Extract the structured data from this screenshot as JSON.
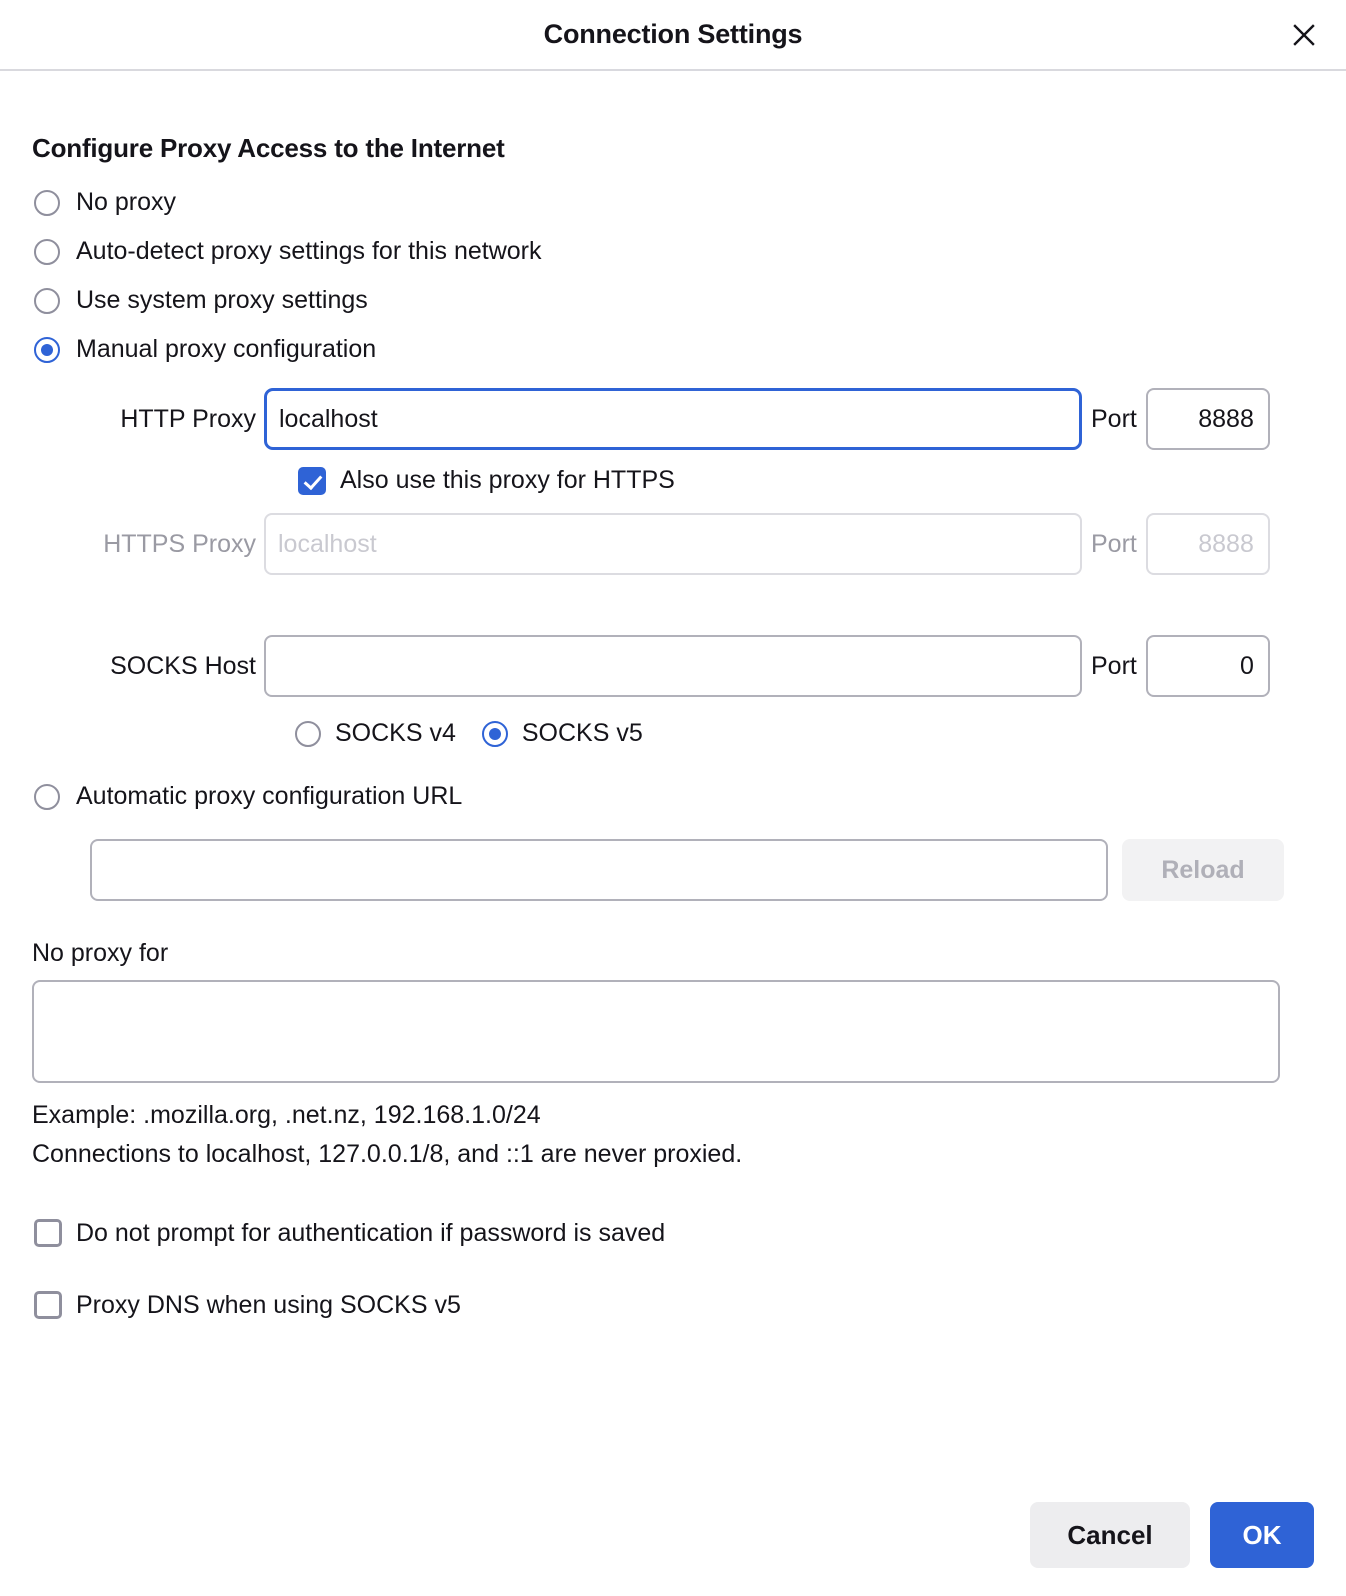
{
  "dialog": {
    "title": "Connection Settings",
    "close_icon": "close-icon"
  },
  "section": {
    "heading": "Configure Proxy Access to the Internet"
  },
  "proxy_modes": [
    {
      "label": "No proxy",
      "selected": false
    },
    {
      "label": "Auto-detect proxy settings for this network",
      "selected": false
    },
    {
      "label": "Use system proxy settings",
      "selected": false
    },
    {
      "label": "Manual proxy configuration",
      "selected": true
    }
  ],
  "manual": {
    "http": {
      "label": "HTTP Proxy",
      "value": "localhost",
      "placeholder": "",
      "focused": true,
      "port_label": "Port",
      "port_value": "8888"
    },
    "also_https": {
      "label": "Also use this proxy for HTTPS",
      "checked": true
    },
    "https": {
      "label": "HTTPS Proxy",
      "value": "",
      "placeholder": "localhost",
      "disabled": true,
      "port_label": "Port",
      "port_value": "8888"
    },
    "socks": {
      "label": "SOCKS Host",
      "value": "",
      "placeholder": "",
      "port_label": "Port",
      "port_value": "0"
    },
    "socks_versions": [
      {
        "label": "SOCKS v4",
        "selected": false
      },
      {
        "label": "SOCKS v5",
        "selected": true
      }
    ]
  },
  "pac": {
    "label": "Automatic proxy configuration URL",
    "selected": false,
    "value": "",
    "placeholder": "",
    "reload_label": "Reload",
    "reload_disabled": true
  },
  "no_proxy": {
    "label": "No proxy for",
    "value": "",
    "placeholder": "",
    "example_line": "Example: .mozilla.org, .net.nz, 192.168.1.0/24",
    "localhost_line": "Connections to localhost, 127.0.0.1/8, and ::1 are never proxied."
  },
  "options": [
    {
      "label": "Do not prompt for authentication if password is saved",
      "checked": false
    },
    {
      "label": "Proxy DNS when using SOCKS v5",
      "checked": false
    }
  ],
  "footer": {
    "cancel_label": "Cancel",
    "ok_label": "OK"
  },
  "colors": {
    "accent": "#2f63d6",
    "border": "#b1b1ba",
    "disabled_text": "#b5b5bd",
    "header_divider": "#d9d9de",
    "cancel_bg": "#ededef"
  }
}
